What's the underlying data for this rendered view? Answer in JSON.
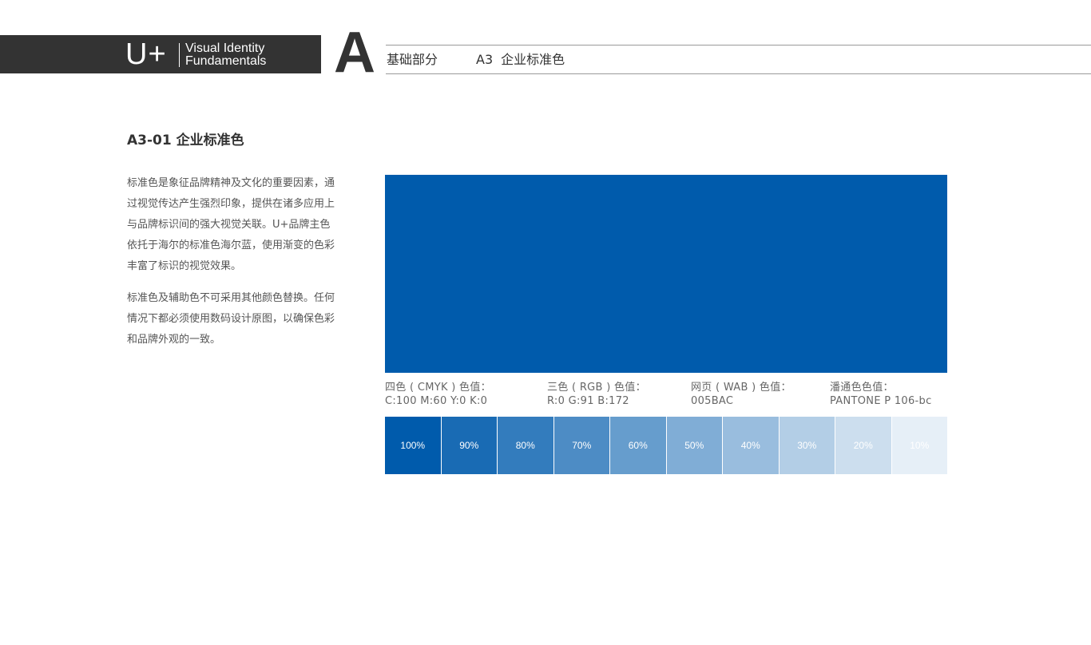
{
  "header": {
    "logo": "U+",
    "brand_line1": "Visual Identity",
    "brand_line2": "Fundamentals",
    "section_letter": "A",
    "category": "基础部分",
    "section_code": "A3",
    "section_title": "企业标准色"
  },
  "content": {
    "title": "A3-01  企业标准色",
    "paragraph1": "标准色是象征品牌精神及文化的重要因素，通过视觉传达产生强烈印象，提供在诸多应用上与品牌标识间的强大视觉关联。U+品牌主色依托于海尔的标准色海尔蓝，使用渐变的色彩丰富了标识的视觉效果。",
    "paragraph2": "标准色及辅助色不可采用其他颜色替换。任何情况下都必须使用数码设计原图，以确保色彩和品牌外观的一致。"
  },
  "colors": {
    "brand_blue": "#005BAC",
    "header_dark": "#333333"
  },
  "specs": {
    "cmyk_label": "四色 ( CMYK ) 色值：",
    "cmyk_value": "C:100   M:60   Y:0   K:0",
    "rgb_label": "三色 ( RGB ) 色值：",
    "rgb_value": "R:0   G:91   B:172",
    "web_label": "网页 ( WAB ) 色值：",
    "web_value": "005BAC",
    "pantone_label": "潘通色色值：",
    "pantone_value": "PANTONE P 106-bc"
  },
  "tints": [
    {
      "label": "100%",
      "opacity": 1.0
    },
    {
      "label": "90%",
      "opacity": 0.9
    },
    {
      "label": "80%",
      "opacity": 0.8
    },
    {
      "label": "70%",
      "opacity": 0.7
    },
    {
      "label": "60%",
      "opacity": 0.6
    },
    {
      "label": "50%",
      "opacity": 0.5
    },
    {
      "label": "40%",
      "opacity": 0.4
    },
    {
      "label": "30%",
      "opacity": 0.3
    },
    {
      "label": "20%",
      "opacity": 0.2
    },
    {
      "label": "10%",
      "opacity": 0.1
    }
  ]
}
